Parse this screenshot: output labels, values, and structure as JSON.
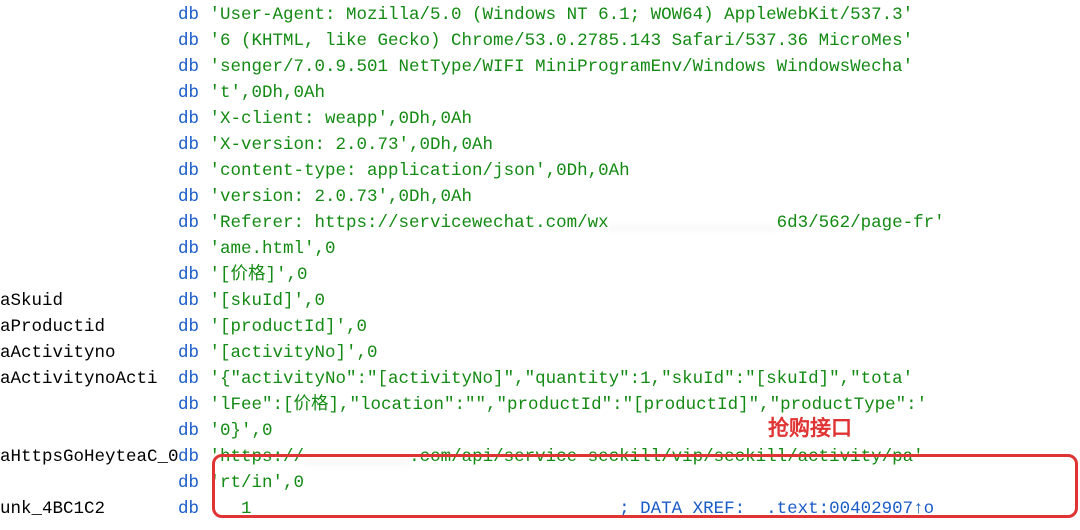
{
  "rows": [
    {
      "label": "",
      "kw": "db",
      "txt": "'User-Agent: Mozilla/5.0 (Windows NT 6.1; WOW64) AppleWebKit/537.3'"
    },
    {
      "label": "",
      "kw": "db",
      "txt": "'6 (KHTML, like Gecko) Chrome/53.0.2785.143 Safari/537.36 MicroMes'"
    },
    {
      "label": "",
      "kw": "db",
      "txt": "'senger/7.0.9.501 NetType/WIFI MiniProgramEnv/Windows WindowsWecha'"
    },
    {
      "label": "",
      "kw": "db",
      "txt": "'t',0Dh,0Ah"
    },
    {
      "label": "",
      "kw": "db",
      "txt": "'X-client: weapp',0Dh,0Ah"
    },
    {
      "label": "",
      "kw": "db",
      "txt": "'X-version: 2.0.73',0Dh,0Ah"
    },
    {
      "label": "",
      "kw": "db",
      "txt": "'content-type: application/json',0Dh,0Ah"
    },
    {
      "label": "",
      "kw": "db",
      "txt": "'version: 2.0.73',0Dh,0Ah"
    },
    {
      "label": "",
      "kw": "db",
      "txt": "'Referer: https://servicewechat.com/wx",
      "blur": "________________",
      "txt2": "6d3/562/page-fr'"
    },
    {
      "label": "",
      "kw": "db",
      "txt": "'ame.html',0"
    },
    {
      "label": "",
      "kw": "db",
      "txt": "'[价格]',0"
    },
    {
      "label": "aSkuid",
      "kw": "db",
      "txt": "'[skuId]',0"
    },
    {
      "label": "aProductid",
      "kw": "db",
      "txt": "'[productId]',0"
    },
    {
      "label": "aActivityno",
      "kw": "db",
      "txt": "'[activityNo]',0"
    },
    {
      "label": "aActivitynoActi",
      "kw": "db",
      "txt": "'{\"activityNo\":\"[activityNo]\",\"quantity\":1,\"skuId\":\"[skuId]\",\"tota'"
    },
    {
      "label": "",
      "kw": "db",
      "txt": "'lFee\":[价格],\"location\":\"\",\"productId\":\"[productId]\",\"productType\":'"
    },
    {
      "label": "",
      "kw": "db",
      "txt": "'0}',0"
    },
    {
      "label": "aHttpsGoHeyteaC_0",
      "kw": "db",
      "txt": "'https://",
      "blur": "__________",
      "txt2": ".com/api/service-seckill/vip/seckill/activity/pa'"
    },
    {
      "label": "",
      "kw": "db",
      "txt": "'rt/in',0"
    },
    {
      "label": "unk_4BC1C2",
      "kw": "db",
      "txt": "   1",
      "xref": "; DATA XREF:  .text:00402907↑o"
    }
  ],
  "annotation": "抢购接口"
}
